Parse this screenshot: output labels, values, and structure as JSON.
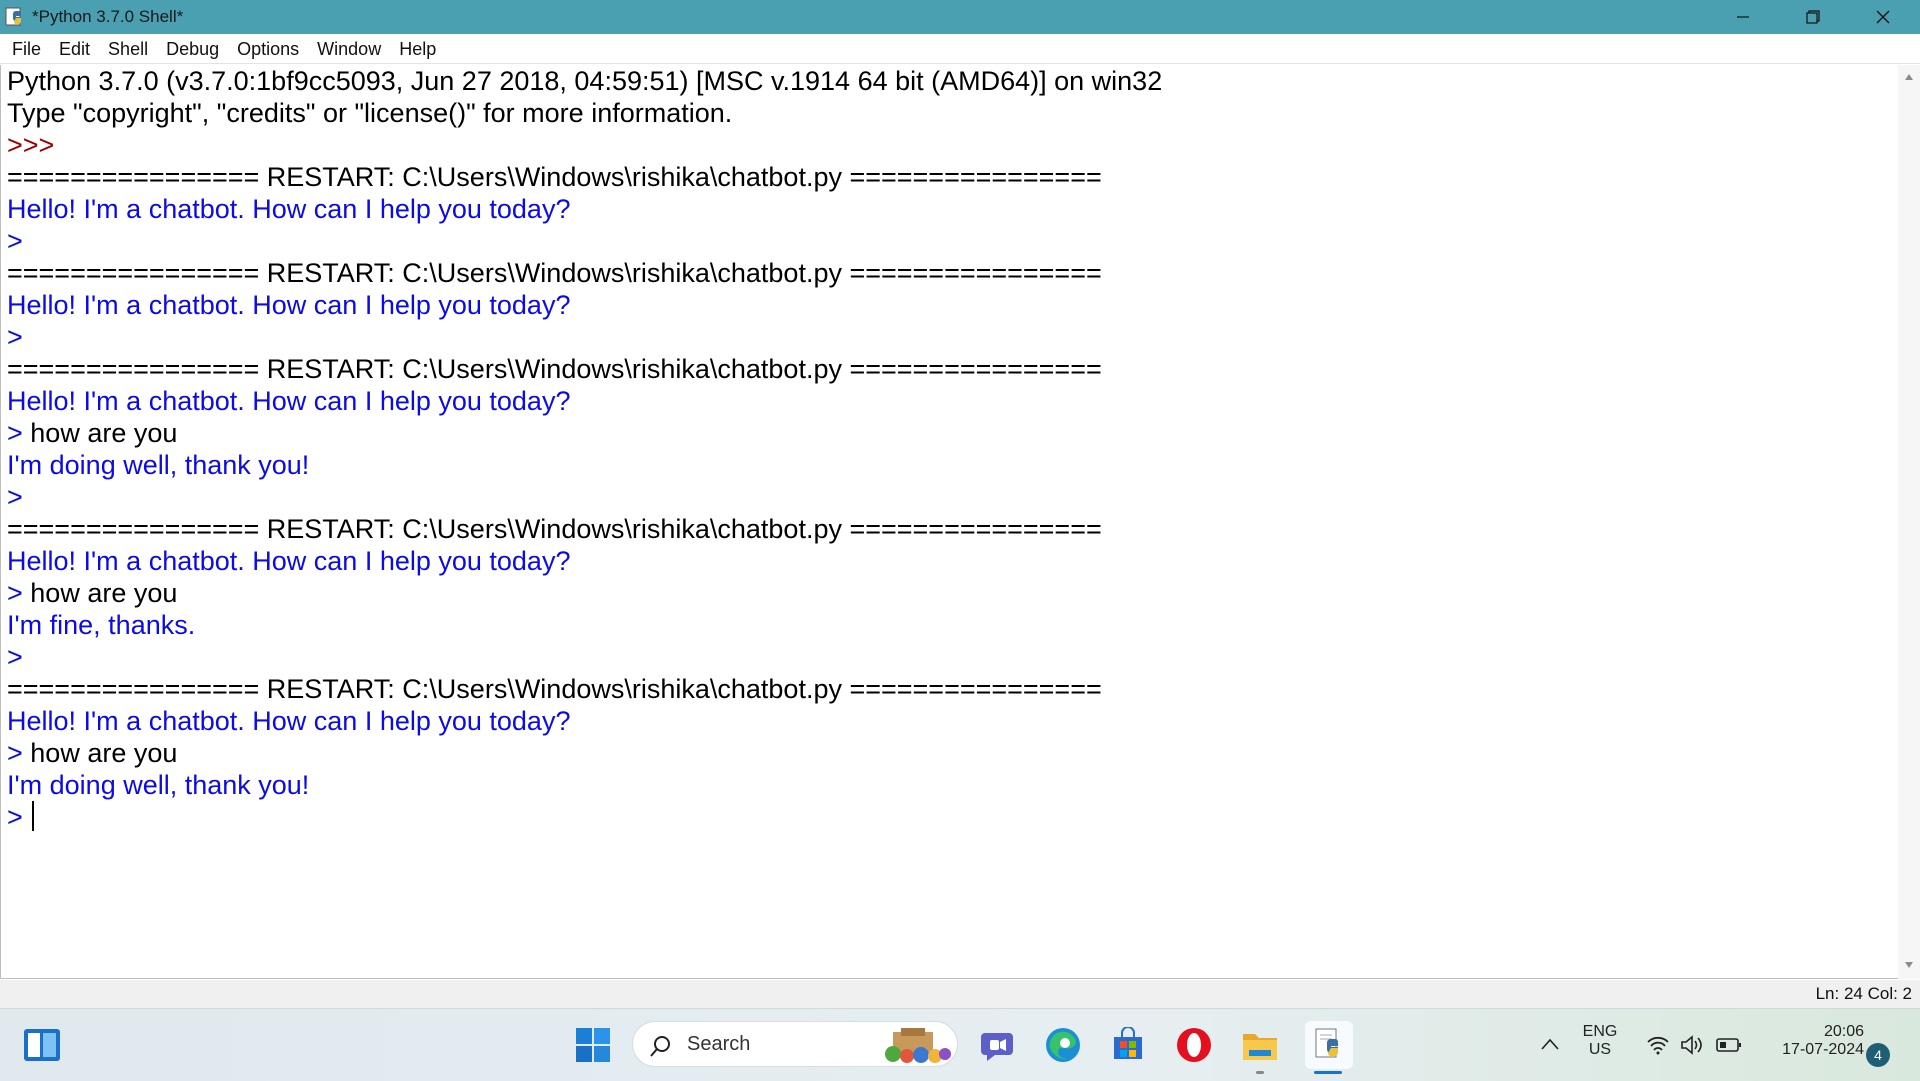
{
  "window": {
    "title": "*Python 3.7.0 Shell*",
    "buttons": {
      "minimize": "minimize-icon",
      "restore": "restore-icon",
      "close": "close-icon"
    }
  },
  "menu": [
    "File",
    "Edit",
    "Shell",
    "Debug",
    "Options",
    "Window",
    "Help"
  ],
  "shell": {
    "lines": [
      {
        "text": "Python 3.7.0 (v3.7.0:1bf9cc5093, Jun 27 2018, 04:59:51) [MSC v.1914 64 bit (AMD64)] on win32",
        "color": "black"
      },
      {
        "text": "Type \"copyright\", \"credits\" or \"license()\" for more information.",
        "color": "black"
      },
      {
        "text": ">>> ",
        "color": "red"
      },
      {
        "text": "================ RESTART: C:\\Users\\Windows\\rishika\\chatbot.py ================",
        "color": "black"
      },
      {
        "text": "Hello! I'm a chatbot. How can I help you today?",
        "color": "blue"
      },
      {
        "text": ">",
        "color": "blue"
      },
      {
        "text": "================ RESTART: C:\\Users\\Windows\\rishika\\chatbot.py ================",
        "color": "black"
      },
      {
        "text": "Hello! I'm a chatbot. How can I help you today?",
        "color": "blue"
      },
      {
        "text": ">",
        "color": "blue"
      },
      {
        "text": "================ RESTART: C:\\Users\\Windows\\rishika\\chatbot.py ================",
        "color": "black"
      },
      {
        "text": "Hello! I'm a chatbot. How can I help you today?",
        "color": "blue"
      },
      {
        "prompt": "> ",
        "input": "how are you"
      },
      {
        "text": "I'm doing well, thank you!",
        "color": "blue"
      },
      {
        "text": ">",
        "color": "blue"
      },
      {
        "text": "================ RESTART: C:\\Users\\Windows\\rishika\\chatbot.py ================",
        "color": "black"
      },
      {
        "text": "Hello! I'm a chatbot. How can I help you today?",
        "color": "blue"
      },
      {
        "prompt": "> ",
        "input": "how are you"
      },
      {
        "text": "I'm fine, thanks.",
        "color": "blue"
      },
      {
        "text": ">",
        "color": "blue"
      },
      {
        "text": "================ RESTART: C:\\Users\\Windows\\rishika\\chatbot.py ================",
        "color": "black"
      },
      {
        "text": "Hello! I'm a chatbot. How can I help you today?",
        "color": "blue"
      },
      {
        "prompt": "> ",
        "input": "how are you"
      },
      {
        "text": "I'm doing well, thank you!",
        "color": "blue"
      },
      {
        "prompt": "> ",
        "input": "",
        "cursor": true
      }
    ]
  },
  "status": {
    "position": "Ln: 24  Col: 2"
  },
  "taskbar": {
    "search_label": "Search",
    "icons": [
      "widgets-icon",
      "start-icon",
      "search-icon",
      "teams-chat-icon",
      "edge-icon",
      "store-icon",
      "opera-icon",
      "file-explorer-icon",
      "python-idle-icon"
    ],
    "tray": {
      "language": "ENG",
      "region": "US",
      "time": "20:06",
      "date": "17-07-2024",
      "notifications": "4"
    }
  },
  "colors": {
    "titlebar": "#4a9fb0",
    "output": "#0b0bea",
    "prompt_red": "#9b0000"
  }
}
